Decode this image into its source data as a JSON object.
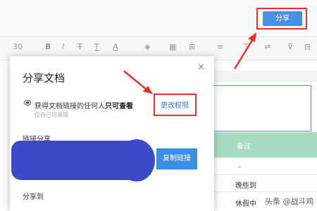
{
  "header": {
    "share_button": "分享"
  },
  "toolbar": {
    "font_size": "30",
    "bold_icon": "B",
    "italic_icon": "I",
    "strike_icon": "T",
    "underline_icon": "T",
    "font_color_icon": "A"
  },
  "dialog": {
    "title": "分享文档",
    "close_icon": "×",
    "permission_prefix": "获得文档链接的任何人",
    "permission_bold": "只可查看",
    "permission_sub": "仅自己可编辑",
    "change_permission": "更改权限",
    "link_share_label": "链接分享",
    "copy_link_button": "复制链接",
    "share_to_label": "分享到"
  },
  "sheet": {
    "column_header": "备注",
    "rows": [
      "-",
      "晚些到",
      "休假中"
    ]
  },
  "watermark": {
    "platform": "头条",
    "account": "@战斗鸡"
  },
  "colors": {
    "accent": "#3b8ee6",
    "highlight": "#e8322e",
    "redaction": "#3d49c9",
    "table_header": "#a8dcc1"
  }
}
